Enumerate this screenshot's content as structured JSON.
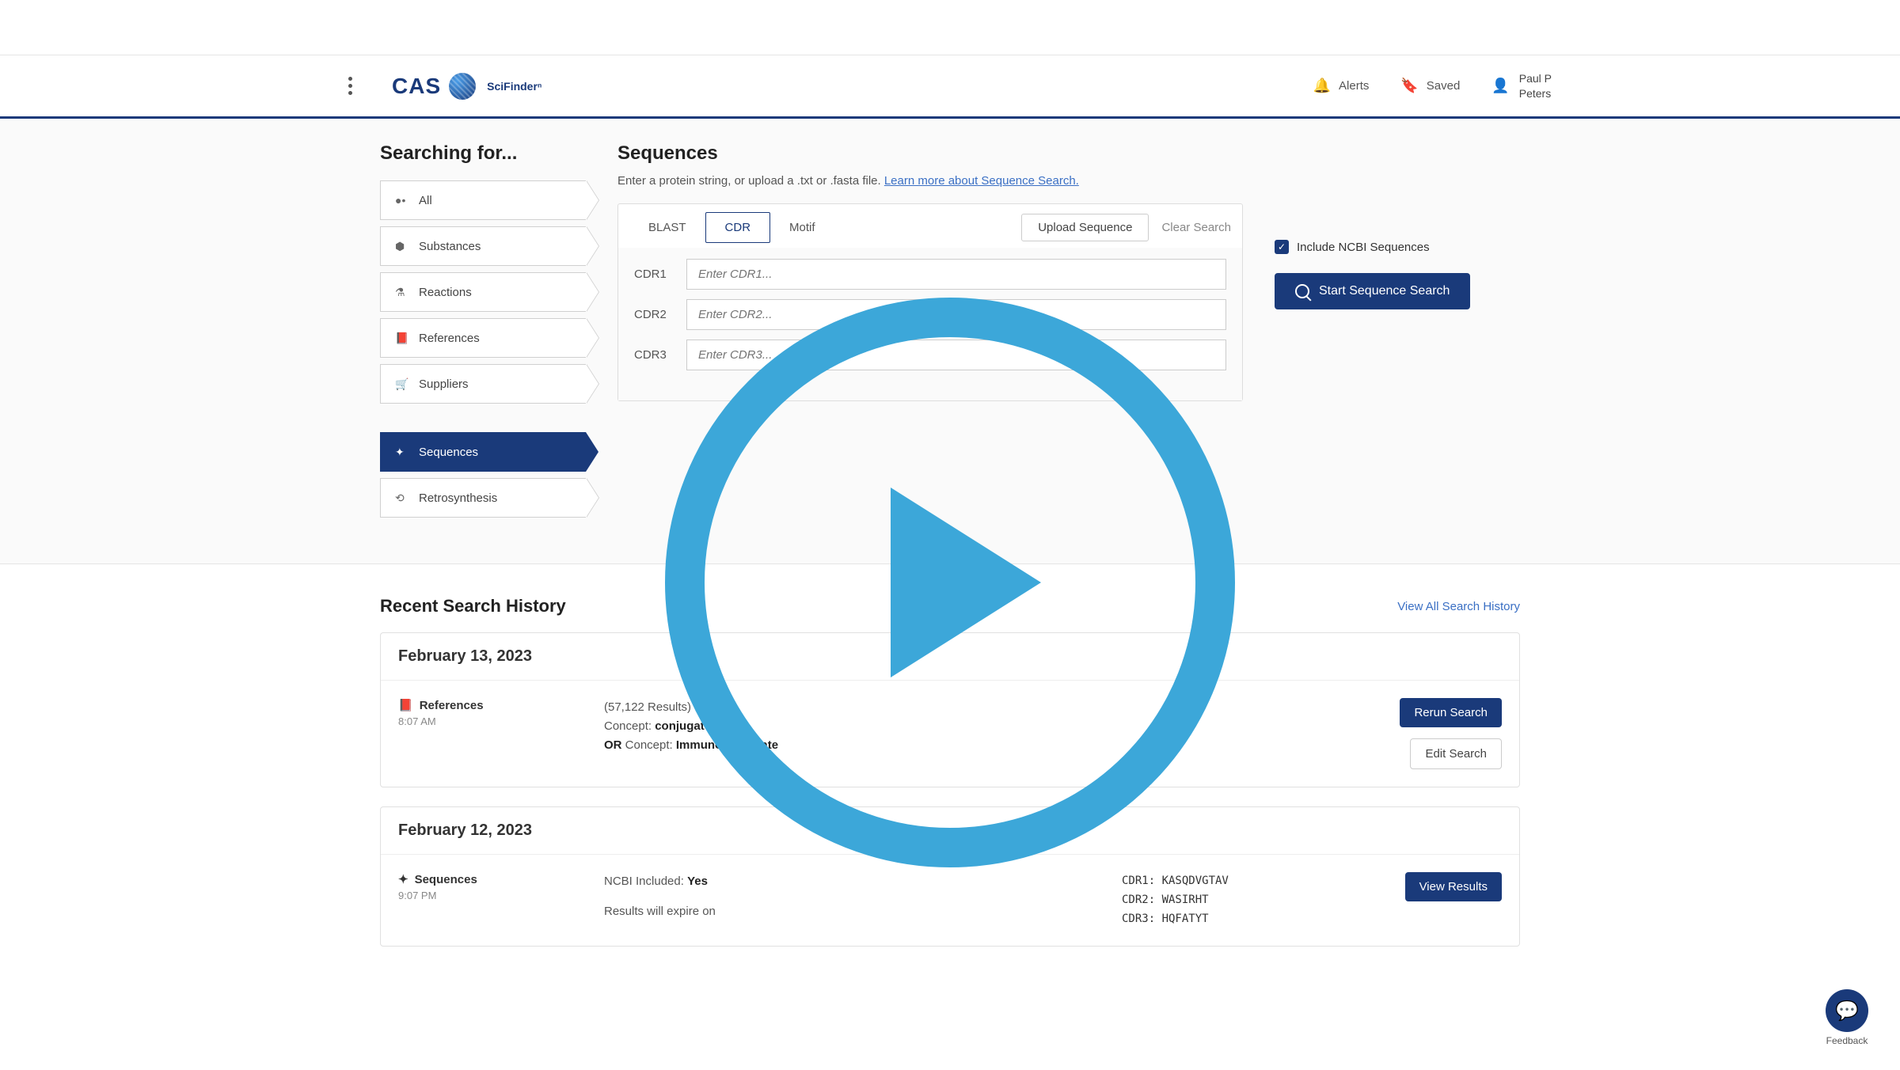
{
  "header": {
    "brand": "CAS",
    "product": "SciFinderⁿ",
    "alerts_label": "Alerts",
    "saved_label": "Saved",
    "user_line1": "Paul P",
    "user_line2": "Peters"
  },
  "sidebar": {
    "title": "Searching for...",
    "items": [
      {
        "label": "All",
        "icon": "●•"
      },
      {
        "label": "Substances",
        "icon": "⬢"
      },
      {
        "label": "Reactions",
        "icon": "⚗"
      },
      {
        "label": "References",
        "icon": "📕"
      },
      {
        "label": "Suppliers",
        "icon": "🛒"
      }
    ],
    "group2": [
      {
        "label": "Sequences",
        "icon": "✦",
        "active": true
      },
      {
        "label": "Retrosynthesis",
        "icon": "⟲"
      }
    ]
  },
  "main": {
    "title": "Sequences",
    "subtitle_pre": "Enter a protein string, or upload a .txt or .fasta file. ",
    "subtitle_link": "Learn more about Sequence Search.",
    "tabs": [
      "BLAST",
      "CDR",
      "Motif"
    ],
    "active_tab": "CDR",
    "upload_label": "Upload Sequence",
    "clear_label": "Clear Search",
    "cdr_rows": [
      {
        "label": "CDR1",
        "placeholder": "Enter CDR1..."
      },
      {
        "label": "CDR2",
        "placeholder": "Enter CDR2..."
      },
      {
        "label": "CDR3",
        "placeholder": "Enter CDR3..."
      }
    ],
    "ncbi_label": "Include NCBI Sequences",
    "start_label": "Start Sequence Search"
  },
  "history": {
    "title": "Recent Search History",
    "view_all": "View All Search History",
    "entries": [
      {
        "date": "February 13, 2023",
        "type": "References",
        "type_icon": "📕",
        "time": "8:07 AM",
        "results": "(57,122 Results)",
        "line1_pre": "Concept: ",
        "line1_bold": "conjugate",
        "line2_bold1": "OR",
        "line2_mid": "  Concept: ",
        "line2_bold2": "Immunoconjugate",
        "action1": "Rerun Search",
        "action2": "Edit Search"
      },
      {
        "date": "February 12, 2023",
        "type": "Sequences",
        "type_icon": "✦",
        "time": "9:07 PM",
        "ncbi_line_pre": "NCBI Included: ",
        "ncbi_line_bold": "Yes",
        "expire_line": "Results will expire on",
        "cdr1": "CDR1: KASQDVGTAV",
        "cdr2": "CDR2: WASIRHT",
        "cdr3": "CDR3: HQFATYT",
        "action1": "View Results"
      }
    ]
  },
  "feedback": {
    "label": "Feedback"
  }
}
